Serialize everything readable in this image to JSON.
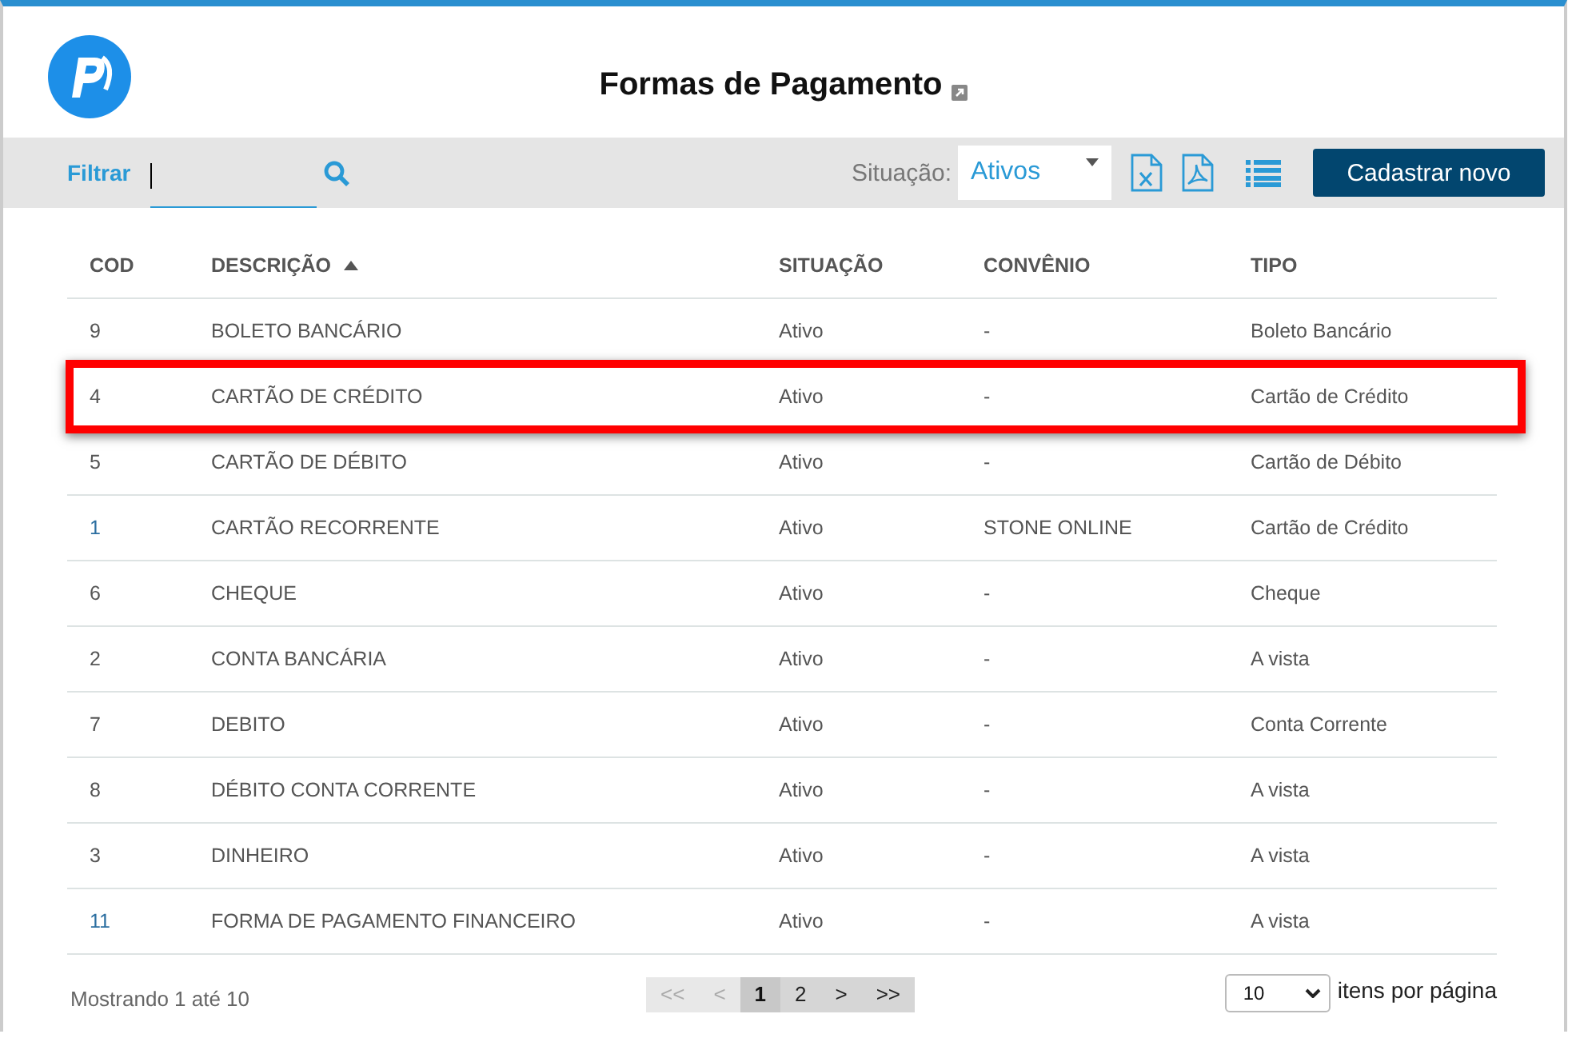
{
  "header": {
    "title": "Formas de Pagamento"
  },
  "toolbar": {
    "filter_label": "Filtrar",
    "status_label": "Situação:",
    "status_value": "Ativos",
    "new_button": "Cadastrar novo"
  },
  "table": {
    "columns": [
      {
        "label": "COD",
        "sorted": false
      },
      {
        "label": "DESCRIÇÃO",
        "sorted": true
      },
      {
        "label": "SITUAÇÃO",
        "sorted": false
      },
      {
        "label": "CONVÊNIO",
        "sorted": false
      },
      {
        "label": "TIPO",
        "sorted": false
      }
    ],
    "rows": [
      {
        "linked": false,
        "highlighted": false,
        "cells": [
          "9",
          "BOLETO BANCÁRIO",
          "Ativo",
          "-",
          "Boleto Bancário"
        ]
      },
      {
        "linked": false,
        "highlighted": true,
        "cells": [
          "4",
          "CARTÃO DE CRÉDITO",
          "Ativo",
          "-",
          "Cartão de Crédito"
        ]
      },
      {
        "linked": false,
        "highlighted": false,
        "cells": [
          "5",
          "CARTÃO DE DÉBITO",
          "Ativo",
          "-",
          "Cartão de Débito"
        ]
      },
      {
        "linked": true,
        "highlighted": false,
        "cells": [
          "1",
          "CARTÃO RECORRENTE",
          "Ativo",
          "STONE ONLINE",
          "Cartão de Crédito"
        ]
      },
      {
        "linked": false,
        "highlighted": false,
        "cells": [
          "6",
          "CHEQUE",
          "Ativo",
          "-",
          "Cheque"
        ]
      },
      {
        "linked": false,
        "highlighted": false,
        "cells": [
          "2",
          "CONTA BANCÁRIA",
          "Ativo",
          "-",
          "A vista"
        ]
      },
      {
        "linked": false,
        "highlighted": false,
        "cells": [
          "7",
          "DEBITO",
          "Ativo",
          "-",
          "Conta Corrente"
        ]
      },
      {
        "linked": false,
        "highlighted": false,
        "cells": [
          "8",
          "DÉBITO CONTA CORRENTE",
          "Ativo",
          "-",
          "A vista"
        ]
      },
      {
        "linked": false,
        "highlighted": false,
        "cells": [
          "3",
          "DINHEIRO",
          "Ativo",
          "-",
          "A vista"
        ]
      },
      {
        "linked": true,
        "highlighted": false,
        "cells": [
          "11",
          "FORMA DE PAGAMENTO FINANCEIRO",
          "Ativo",
          "-",
          "A vista"
        ]
      }
    ]
  },
  "footer": {
    "showing": "Mostrando 1 até 10",
    "pages": [
      {
        "label": "<<",
        "selected": false,
        "disabled": true
      },
      {
        "label": "<",
        "selected": false,
        "disabled": true
      },
      {
        "label": "1",
        "selected": true,
        "disabled": false
      },
      {
        "label": "2",
        "selected": false,
        "disabled": false
      },
      {
        "label": ">",
        "selected": false,
        "disabled": false
      },
      {
        "label": ">>",
        "selected": false,
        "disabled": false
      }
    ],
    "per_page_value": "10",
    "per_page_label": "itens por página"
  }
}
